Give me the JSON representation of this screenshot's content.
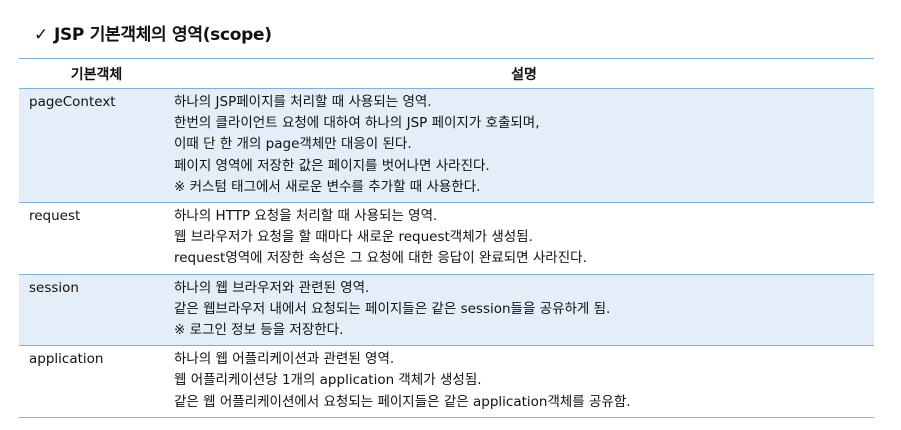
{
  "heading": {
    "check": "✓",
    "title": "JSP 기본객체의 영역(scope)"
  },
  "colors": {
    "row_shade": "#e3eef8",
    "rule": "#7fb0d8"
  },
  "table": {
    "headers": [
      "기본객체",
      "설명"
    ],
    "rows": [
      {
        "name": "pageContext",
        "lines": [
          "하나의 JSP페이지를 처리할 때 사용되는 영역.",
          "한번의 클라이언트 요청에 대하여 하나의 JSP 페이지가 호출되며,",
          "이때 단 한 개의 page객체만 대응이 된다.",
          "페이지 영역에 저장한 값은 페이지를 벗어나면 사라진다.",
          "※ 커스텀 태그에서 새로운 변수를 추가할 때 사용한다."
        ]
      },
      {
        "name": "request",
        "lines": [
          "하나의 HTTP 요청을 처리할 때 사용되는 영역.",
          "웹 브라우저가 요청을 할 때마다 새로운 request객체가 생성됨.",
          "request영역에 저장한 속성은 그 요청에 대한 응답이 완료되면 사라진다."
        ]
      },
      {
        "name": "session",
        "lines": [
          "하나의 웹 브라우저와 관련된 영역.",
          "같은 웹브라우저 내에서 요청되는 페이지들은 같은 session들을 공유하게 됨.",
          "※ 로그인 정보 등을 저장한다."
        ]
      },
      {
        "name": "application",
        "lines": [
          "하나의 웹 어플리케이션과 관련된 영역.",
          "웹 어플리케이션당 1개의 application 객체가 생성됨.",
          "같은 웹 어플리케이션에서 요청되는 페이지들은 같은 application객체를 공유함."
        ]
      }
    ]
  }
}
